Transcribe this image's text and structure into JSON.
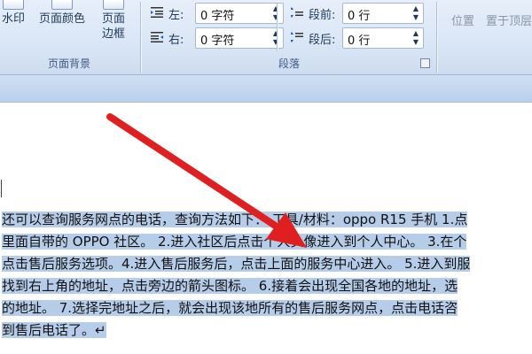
{
  "ribbon": {
    "watermark_label": "水印",
    "page_color_label": "页面颜色",
    "page_border_label": [
      "页面",
      "边框"
    ],
    "page_background_group": "页面背景",
    "paragraph_group": "段落",
    "indent_left_label": "左:",
    "indent_left_value": "0 字符",
    "indent_right_label": "右:",
    "indent_right_value": "0 字符",
    "spacing_before_label": "段前:",
    "spacing_before_value": "0 行",
    "spacing_after_label": "段后:",
    "spacing_after_value": "0 行",
    "position_label": "位置",
    "bring_front_label": "置于顶层"
  },
  "document": {
    "lines": [
      "还可以查询服务网点的电话，查询方法如下：  工具/材料：oppo R15 手机 1.点",
      "里面自带的 OPPO 社区。 2.进入社区后点击个人头像进入到个人中心。 3.在个",
      "点击售后服务选项。4.进入售后服务后，点击上面的服务中心进入。 5.进入到服",
      "找到右上角的地址，点击旁边的箭头图标。 6.接着会出现全国各地的地址，选",
      "的地址。 7.选择完地址之后，就会出现该地所有的售后服务网点，点击电话咨",
      "到售后电话了。↵"
    ]
  },
  "colors": {
    "ribbon_bg": "#dbe7f6",
    "selection": "#b6cde9",
    "arrow": "#e02020"
  }
}
